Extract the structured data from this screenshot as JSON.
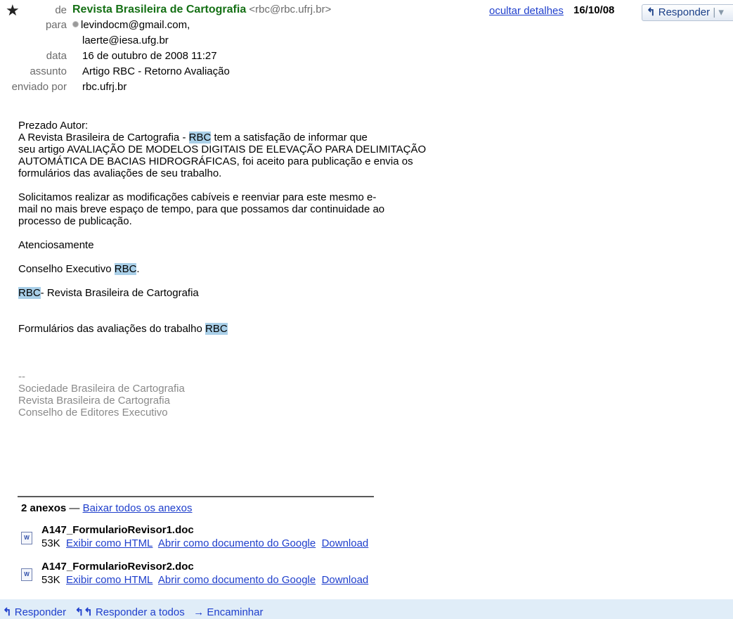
{
  "header": {
    "from_label": "de",
    "from_name": "Revista Brasileira de Cartografia",
    "from_email": "<rbc@rbc.ufrj.br>",
    "hide_details": "ocultar detalhes",
    "date_short": "16/10/08",
    "reply_button": "Responder",
    "to_label": "para",
    "to_1": "levindocm@gmail.com,",
    "to_2": "laerte@iesa.ufg.br",
    "date_label": "data",
    "date_value": "16 de outubro de 2008 11:27",
    "subject_label": "assunto",
    "subject_value": "Artigo RBC - Retorno Avaliação",
    "sent_by_label": "enviado por",
    "sent_by_value": "rbc.ufrj.br"
  },
  "body": {
    "greeting": "Prezado Autor:",
    "p1_a": "A Revista Brasileira de Cartografia - ",
    "rbc": "RBC",
    "p1_b": " tem a satisfação de informar que",
    "p1_c": "seu artigo AVALIAÇÃO DE MODELOS DIGITAIS DE ELEVAÇÃO PARA DELIMITAÇÃO",
    "p1_d": "AUTOMÁTICA DE BACIAS HIDROGRÁFICAS, foi aceito para publicação e envia os",
    "p1_e": "formulários das avaliações de seu trabalho.",
    "p2_a": "Solicitamos realizar as modificações cabíveis e reenviar para este mesmo e-",
    "p2_b": "mail no mais breve espaço de tempo, para que possamos dar continuidade ao",
    "p2_c": "processo de publicação.",
    "regards": "Atenciosamente",
    "council_a": "Conselho Executivo ",
    "council_b": ".",
    "rbc_line_b": "- Revista Brasileira de Cartografia",
    "forms_a": "Formulários das avaliações do trabalho ",
    "sig_dash": "--",
    "sig_1": "Sociedade Brasileira de Cartografia",
    "sig_2": "Revista Brasileira de Cartografia",
    "sig_3": "Conselho de Editores Executivo"
  },
  "attachments": {
    "count_label": "2 anexos",
    "dash": " — ",
    "download_all": "Baixar todos os anexos",
    "items": [
      {
        "name": "A147_FormularioRevisor1.doc",
        "size": "53K",
        "view_html": "Exibir como HTML",
        "open_google": "Abrir como documento do Google",
        "download": "Download"
      },
      {
        "name": "A147_FormularioRevisor2.doc",
        "size": "53K",
        "view_html": "Exibir como HTML",
        "open_google": "Abrir como documento do Google",
        "download": "Download"
      }
    ]
  },
  "actions": {
    "reply": "Responder",
    "reply_all": "Responder a todos",
    "forward": "Encaminhar"
  },
  "colors": {
    "sender": "#157015",
    "link": "#1f3fcc",
    "highlight": "#a9cfe8",
    "action_bar": "#e0edf8"
  }
}
